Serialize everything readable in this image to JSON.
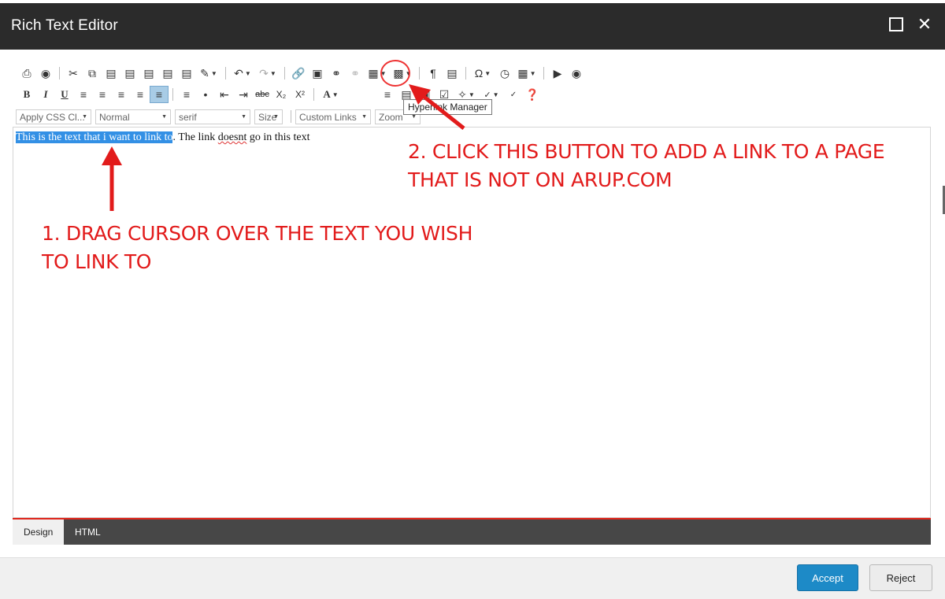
{
  "window": {
    "title": "Rich Text Editor",
    "maximize_icon": "maximize-icon",
    "close_symbol": "✕"
  },
  "toolbar": {
    "font_dropdowns": {
      "css_class": "Apply CSS Cl...",
      "paragraph": "Normal",
      "font": "serif",
      "size": "Size",
      "links": "Custom Links",
      "zoom": "Zoom"
    },
    "tooltip": "Hyperlink Manager"
  },
  "content": {
    "selected_text": "This is the text that i want to link to",
    "rest_before": ". The link ",
    "misspelled": "doesnt",
    "rest_after": " go in this text"
  },
  "modes": {
    "design": "Design",
    "html": "HTML"
  },
  "footer": {
    "accept": "Accept",
    "reject": "Reject"
  },
  "annotations": {
    "step1_line1": "1. DRAG CURSOR OVER THE TEXT YOU WISH",
    "step1_line2": "TO LINK TO",
    "step2_line1": "2. CLICK THIS BUTTON TO ADD A LINK TO A PAGE",
    "step2_line2": "THAT IS NOT ON ARUP.COM",
    "color": "#e21b1b"
  },
  "colors": {
    "title_bar": "#2b2b2b",
    "accent_red": "#e0261c",
    "accept_blue": "#1d8ac7",
    "selection": "#3390e5"
  }
}
